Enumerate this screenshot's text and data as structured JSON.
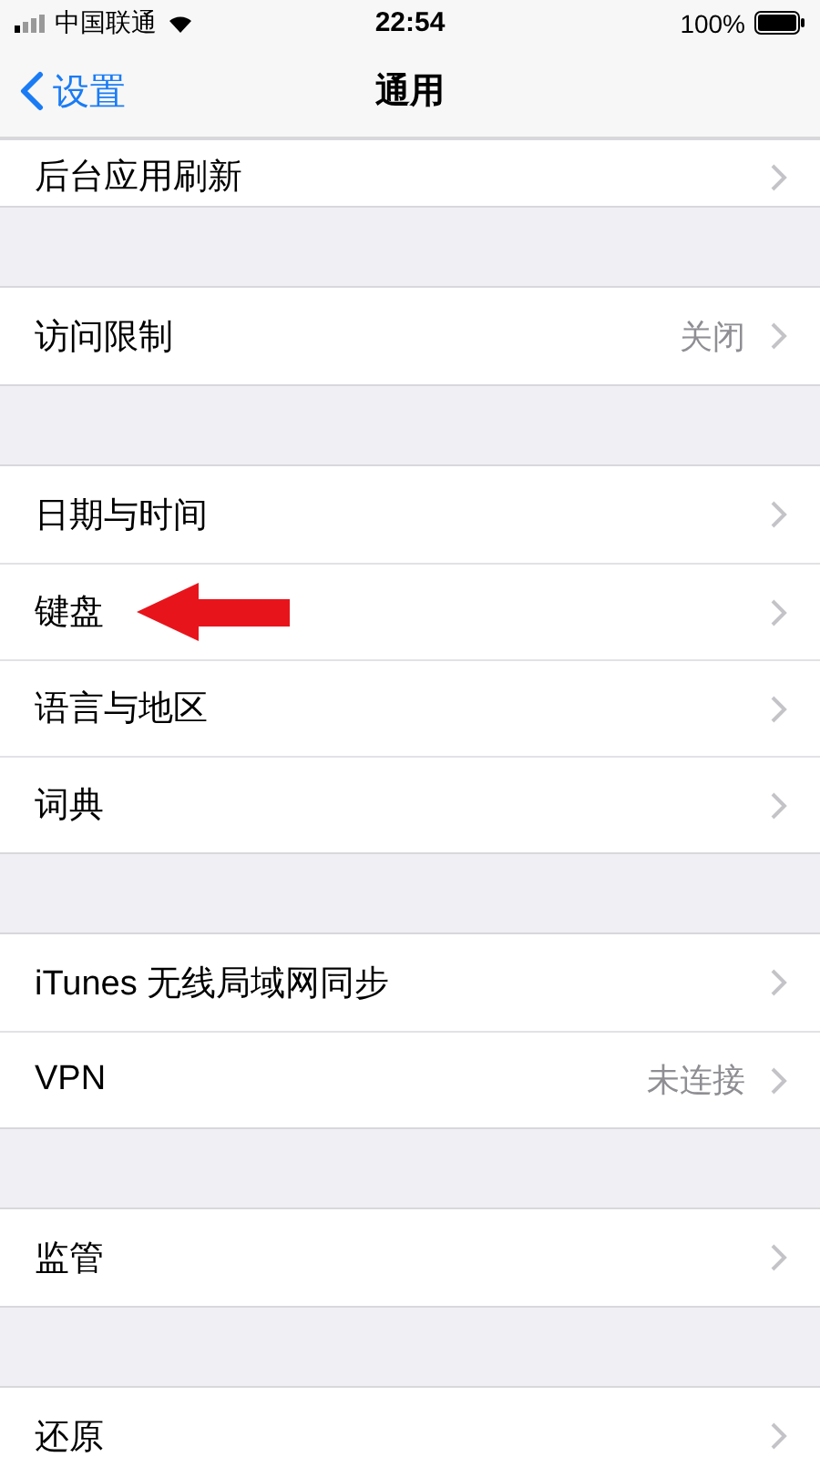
{
  "status_bar": {
    "carrier": "中国联通",
    "time": "22:54",
    "battery": "100%"
  },
  "nav": {
    "back": "设置",
    "title": "通用"
  },
  "groups": [
    {
      "partial": true,
      "rows": [
        {
          "label": "后台应用刷新",
          "marked": false
        }
      ]
    },
    {
      "partial": false,
      "rows": [
        {
          "label": "访问限制",
          "value": "关闭",
          "marked": false
        }
      ]
    },
    {
      "partial": false,
      "rows": [
        {
          "label": "日期与时间",
          "marked": false
        },
        {
          "label": "键盘",
          "marked": true
        },
        {
          "label": "语言与地区",
          "marked": false
        },
        {
          "label": "词典",
          "marked": false
        }
      ]
    },
    {
      "partial": false,
      "rows": [
        {
          "label": "iTunes 无线局域网同步",
          "marked": false
        },
        {
          "label": "VPN",
          "value": "未连接",
          "marked": false
        }
      ]
    },
    {
      "partial": false,
      "rows": [
        {
          "label": "监管",
          "marked": false
        }
      ]
    },
    {
      "partial": false,
      "rows": [
        {
          "label": "还原",
          "marked": false
        }
      ]
    }
  ]
}
